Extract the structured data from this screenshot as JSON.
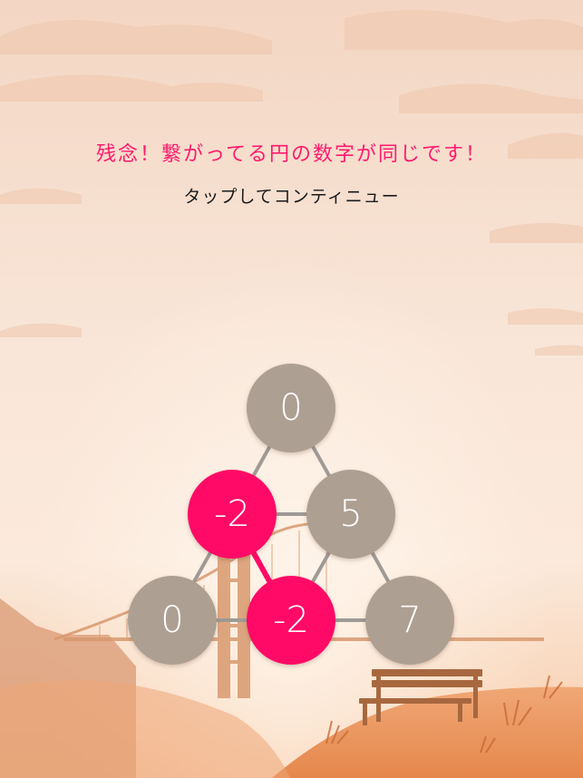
{
  "message": {
    "error": "残念！繋がってる円の数字が同じです！",
    "continue": "タップしてコンティニュー"
  },
  "colors": {
    "error_text": "#ff1a6e",
    "node_normal": "#ae9f93",
    "node_conflict": "#ff0a66",
    "edge_normal": "#9f9a96",
    "edge_conflict": "#ff0a66"
  },
  "puzzle": {
    "nodes": [
      {
        "id": "n1",
        "value": "0",
        "conflict": false
      },
      {
        "id": "n2",
        "value": "-2",
        "conflict": true
      },
      {
        "id": "n3",
        "value": "5",
        "conflict": false
      },
      {
        "id": "n4",
        "value": "0",
        "conflict": false
      },
      {
        "id": "n5",
        "value": "-2",
        "conflict": true
      },
      {
        "id": "n6",
        "value": "7",
        "conflict": false
      }
    ],
    "edges": [
      {
        "from": "n1",
        "to": "n2",
        "conflict": false
      },
      {
        "from": "n1",
        "to": "n3",
        "conflict": false
      },
      {
        "from": "n2",
        "to": "n3",
        "conflict": false
      },
      {
        "from": "n2",
        "to": "n4",
        "conflict": false
      },
      {
        "from": "n2",
        "to": "n5",
        "conflict": true
      },
      {
        "from": "n3",
        "to": "n5",
        "conflict": false
      },
      {
        "from": "n3",
        "to": "n6",
        "conflict": false
      },
      {
        "from": "n4",
        "to": "n5",
        "conflict": false
      },
      {
        "from": "n5",
        "to": "n6",
        "conflict": false
      }
    ]
  }
}
